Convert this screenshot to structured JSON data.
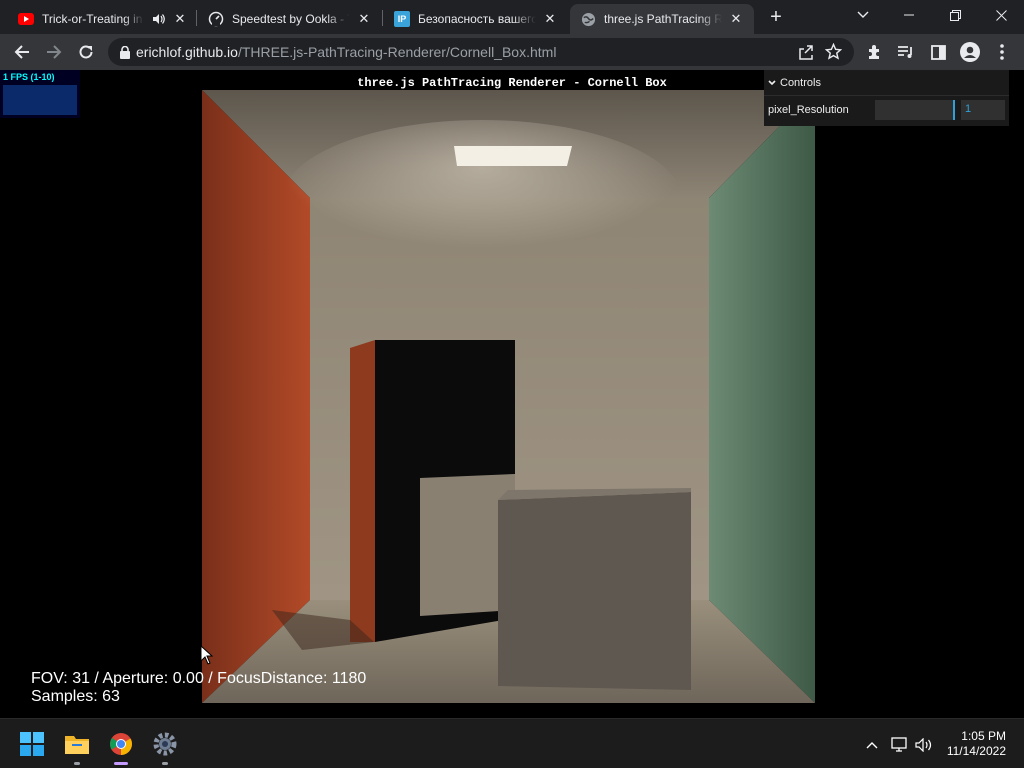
{
  "tabs": [
    {
      "title": "Trick-or-Treating in ",
      "icon": "youtube-icon",
      "audio": true
    },
    {
      "title": "Speedtest by Ookla - Th",
      "icon": "speedtest-icon"
    },
    {
      "title": "Безопасность вашего",
      "icon": "ip-icon",
      "icon_text": "IP"
    },
    {
      "title": "three.js PathTracing Ren",
      "icon": "globe-icon",
      "active": true
    }
  ],
  "toolbar": {
    "url_host": "erichlof.github.io",
    "url_path": "/THREE.js-PathTracing-Renderer/Cornell_Box.html"
  },
  "page": {
    "title": "three.js PathTracing Renderer - Cornell Box",
    "fps_label": "1 FPS (1-10)",
    "hud_line1": "FOV: 31 / Aperture: 0.00 / FocusDistance: 1180",
    "hud_line2": "Samples: 63"
  },
  "gui": {
    "header": "Controls",
    "param_label": "pixel_Resolution",
    "param_value": "1",
    "slider_fraction": 1.0,
    "accent": "#2fa1d6"
  },
  "taskbar": {
    "time": "1:05 PM",
    "date": "11/14/2022"
  },
  "colors": {
    "tab_bg": "#202124",
    "toolbar_bg": "#35363a",
    "left_wall": "#a8452a",
    "right_wall": "#5a7a64",
    "back_wall": "#9a8c7a"
  }
}
